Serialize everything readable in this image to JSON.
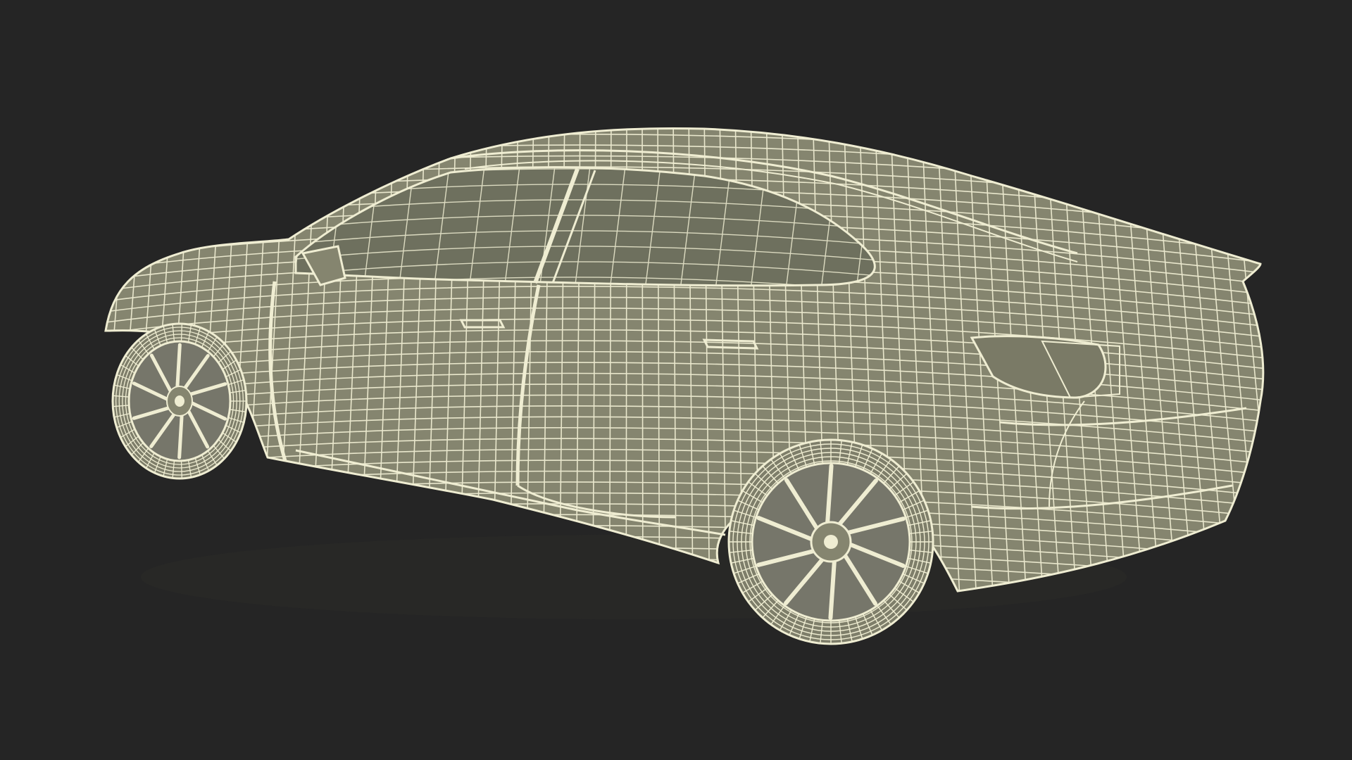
{
  "scene": {
    "subject": "car-wireframe-render",
    "colors": {
      "background": "#252525",
      "body_fill": "#85856f",
      "glass_fill": "#6e705e",
      "tire_fill": "#7e7e6a",
      "rim_fill": "#76766a",
      "wire": "#efedd2",
      "shadow": "#3a3a34"
    }
  }
}
